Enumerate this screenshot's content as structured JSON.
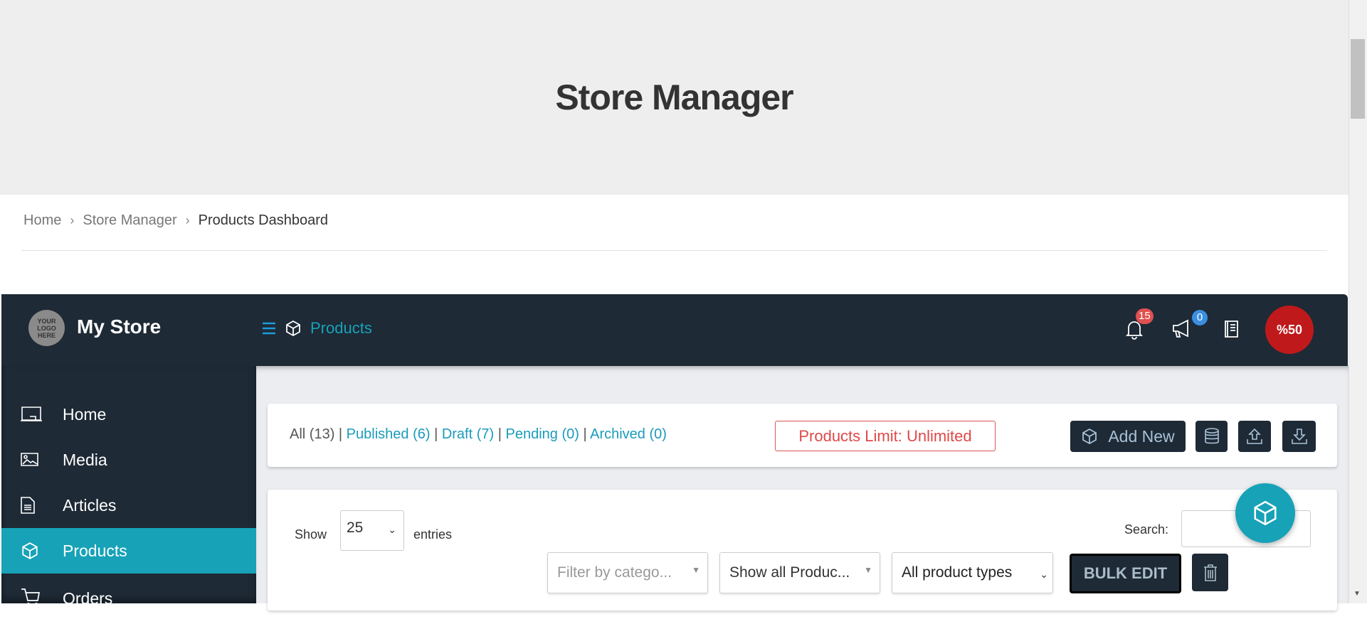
{
  "hero": {
    "title": "Store Manager"
  },
  "breadcrumb": [
    "Home",
    "Store Manager",
    "Products Dashboard"
  ],
  "topbar": {
    "logo_text": "YOUR LOGO HERE",
    "store_name": "My Store",
    "section": "Products",
    "notifications": "15",
    "announcements": "0",
    "avatar_text": "%50"
  },
  "sidebar": {
    "items": [
      {
        "label": "Home",
        "icon": "home-icon"
      },
      {
        "label": "Media",
        "icon": "media-icon"
      },
      {
        "label": "Articles",
        "icon": "articles-icon"
      },
      {
        "label": "Products",
        "icon": "box-icon",
        "active": true
      },
      {
        "label": "Orders",
        "icon": "cart-icon"
      }
    ]
  },
  "status": {
    "all": "All (13)",
    "published": "Published (6)",
    "draft": "Draft (7)",
    "pending": "Pending (0)",
    "archived": "Archived (0)",
    "sep": " | "
  },
  "limit": "Products Limit: Unlimited",
  "actions": {
    "add_new": "Add New"
  },
  "table": {
    "show": "Show",
    "entries_value": "25",
    "entries": "entries",
    "search_label": "Search:",
    "search_value": "",
    "filter_category_placeholder": "Filter by catego...",
    "filter_status": "Show all Produc...",
    "filter_type": "All product types",
    "bulk_edit": "BULK EDIT"
  },
  "colors": {
    "dark": "#1e2a36",
    "accent": "#17a2b8",
    "danger": "#e04848",
    "link": "#1a9bbb"
  }
}
